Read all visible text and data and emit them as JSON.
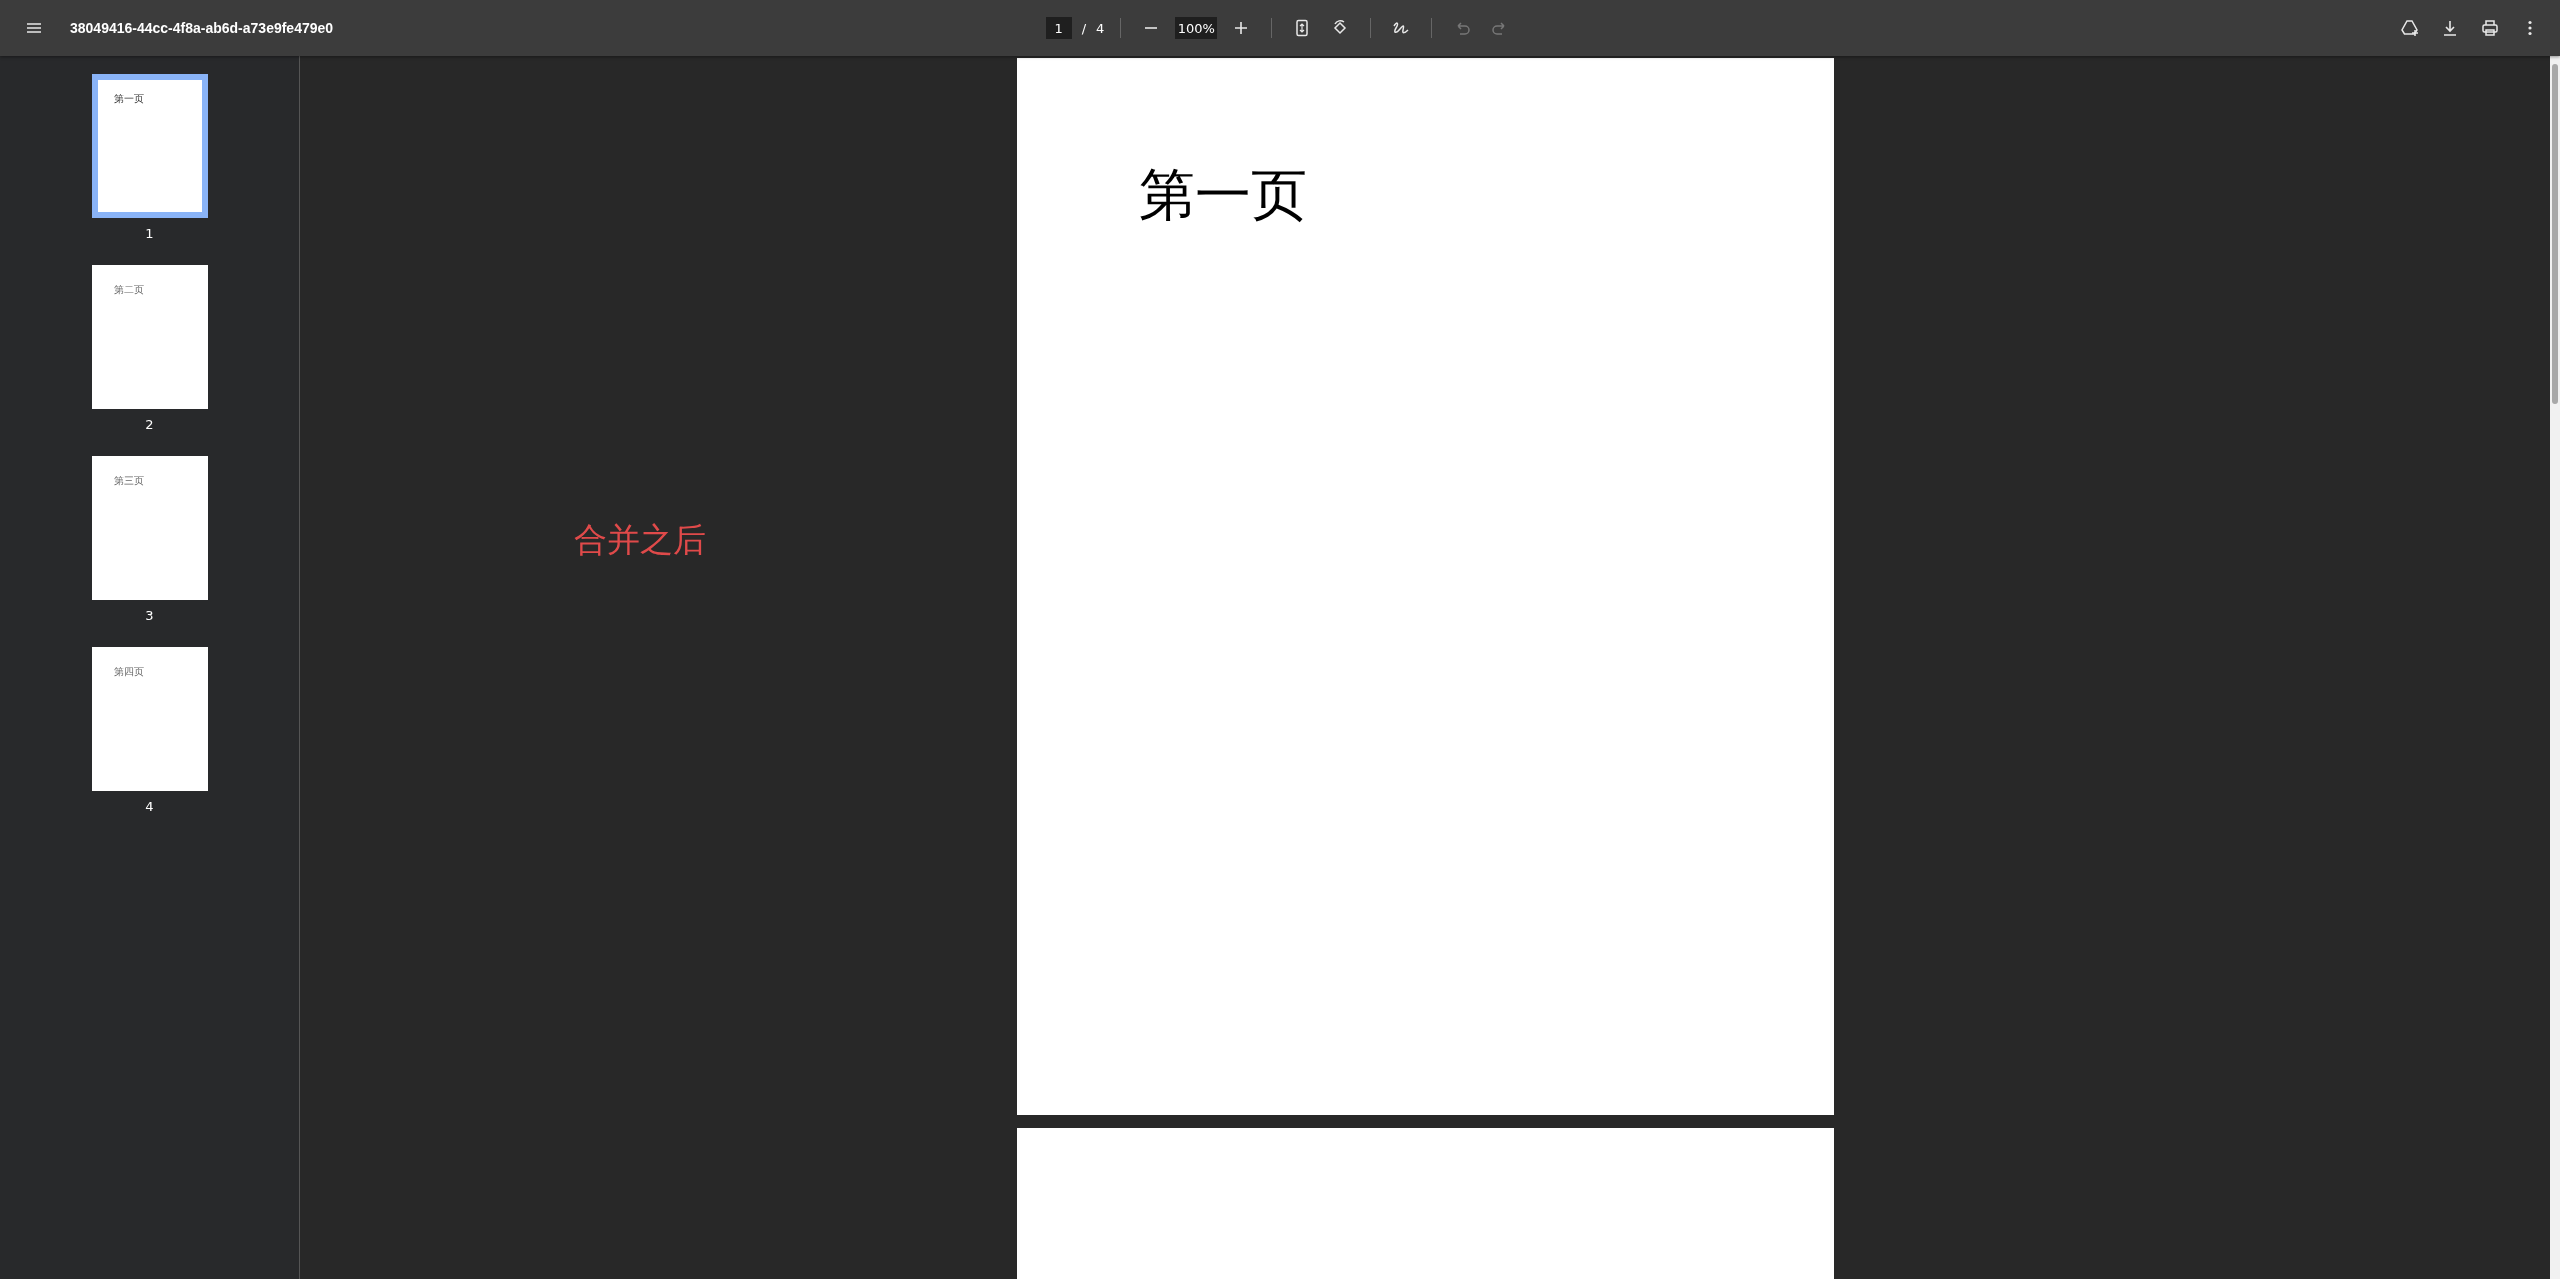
{
  "toolbar": {
    "title": "38049416-44cc-4f8a-ab6d-a73e9fe479e0",
    "page_input": "1",
    "page_separator": "/",
    "page_count": "4",
    "zoom_value": "100%",
    "undo": {
      "disabled": true
    },
    "redo": {
      "disabled": true
    }
  },
  "thumbnails": [
    {
      "text": "第一页",
      "number": "1",
      "selected": true
    },
    {
      "text": "第二页",
      "number": "2",
      "selected": false
    },
    {
      "text": "第三页",
      "number": "3",
      "selected": false
    },
    {
      "text": "第四页",
      "number": "4",
      "selected": false
    }
  ],
  "pages": [
    {
      "heading": "第一页"
    }
  ],
  "annotation": {
    "text": "合并之后"
  }
}
